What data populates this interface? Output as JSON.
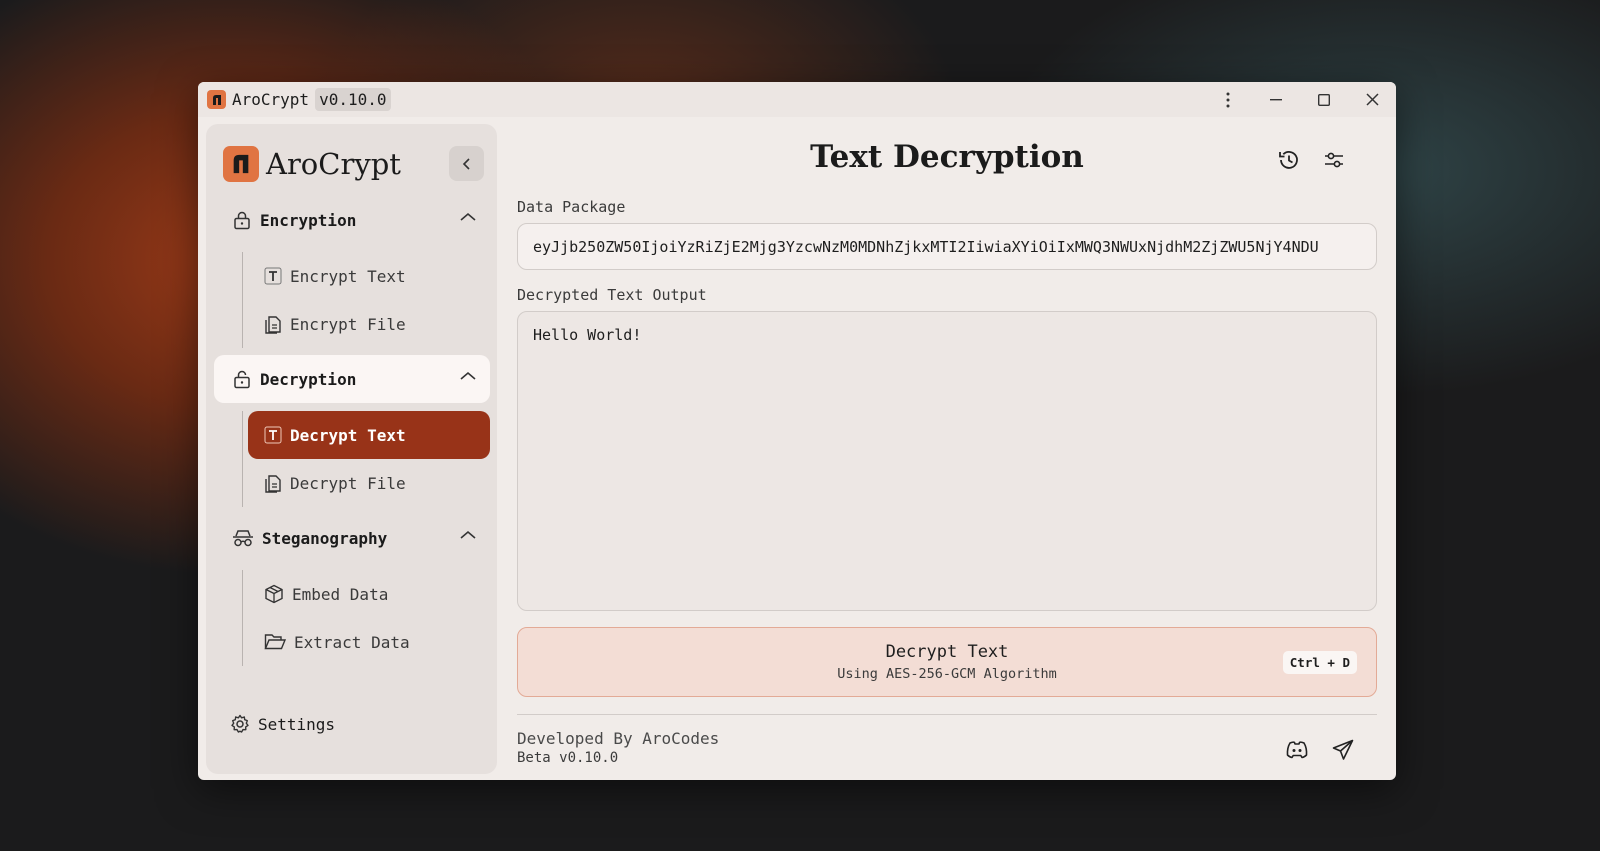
{
  "window": {
    "app_name": "AroCrypt",
    "version": "v0.10.0"
  },
  "sidebar": {
    "brand": "AroCrypt",
    "sections": [
      {
        "label": "Encryption",
        "icon": "lock-icon",
        "expanded": true,
        "items": [
          {
            "label": "Encrypt Text",
            "icon": "text-icon"
          },
          {
            "label": "Encrypt File",
            "icon": "file-icon"
          }
        ]
      },
      {
        "label": "Decryption",
        "icon": "unlock-icon",
        "expanded": true,
        "active": true,
        "items": [
          {
            "label": "Decrypt Text",
            "icon": "text-icon",
            "active": true
          },
          {
            "label": "Decrypt File",
            "icon": "file-icon"
          }
        ]
      },
      {
        "label": "Steganography",
        "icon": "spy-icon",
        "expanded": true,
        "items": [
          {
            "label": "Embed Data",
            "icon": "box-icon"
          },
          {
            "label": "Extract Data",
            "icon": "folder-open-icon"
          }
        ]
      }
    ],
    "settings_label": "Settings"
  },
  "main": {
    "title": "Text Decryption",
    "data_package": {
      "label": "Data Package",
      "value": "eyJjb250ZW50IjoiYzRiZjE2Mjg3YzcwNzM0MDNhZjkxMTI2IiwiaXYiOiIxMWQ3NWUxNjdhM2ZjZWU5NjY4NDU"
    },
    "output": {
      "label": "Decrypted Text Output",
      "value": "Hello World!"
    },
    "decrypt_button": {
      "label": "Decrypt Text",
      "subtitle": "Using AES-256-GCM Algorithm",
      "shortcut": "Ctrl + D"
    },
    "footer": {
      "developer": "Developed By AroCodes",
      "version": "Beta v0.10.0"
    }
  },
  "colors": {
    "accent": "#983318",
    "brand_orange": "#e07442",
    "button_bg": "#f3ddd5"
  }
}
